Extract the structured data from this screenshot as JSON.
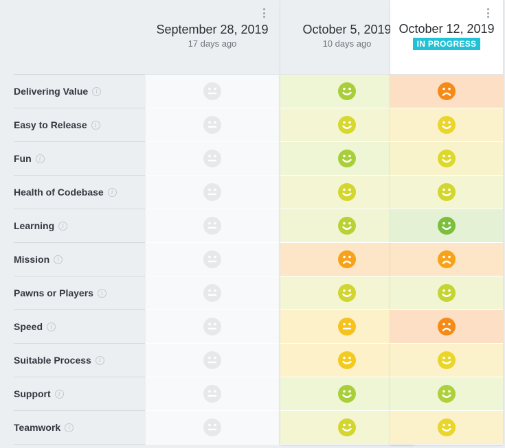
{
  "metrics": [
    {
      "name": "Delivering Value"
    },
    {
      "name": "Easy to Release"
    },
    {
      "name": "Fun"
    },
    {
      "name": "Health of Codebase"
    },
    {
      "name": "Learning"
    },
    {
      "name": "Mission"
    },
    {
      "name": "Pawns or Players"
    },
    {
      "name": "Speed"
    },
    {
      "name": "Suitable Process"
    },
    {
      "name": "Support"
    },
    {
      "name": "Teamwork"
    }
  ],
  "info_icon_glyph": "i",
  "sessions": [
    {
      "date": "September 28, 2019",
      "ago": "17 days ago",
      "status": "",
      "cells": [
        {
          "mood": "neutral",
          "face": "#e6e8ea",
          "bg": "#f8f9fa"
        },
        {
          "mood": "neutral",
          "face": "#e6e8ea",
          "bg": "#f8f9fa"
        },
        {
          "mood": "neutral",
          "face": "#e6e8ea",
          "bg": "#f8f9fa"
        },
        {
          "mood": "neutral",
          "face": "#e6e8ea",
          "bg": "#f8f9fa"
        },
        {
          "mood": "neutral",
          "face": "#e6e8ea",
          "bg": "#f8f9fa"
        },
        {
          "mood": "neutral",
          "face": "#e6e8ea",
          "bg": "#f8f9fa"
        },
        {
          "mood": "neutral",
          "face": "#e6e8ea",
          "bg": "#f8f9fa"
        },
        {
          "mood": "neutral",
          "face": "#e6e8ea",
          "bg": "#f8f9fa"
        },
        {
          "mood": "neutral",
          "face": "#e6e8ea",
          "bg": "#f8f9fa"
        },
        {
          "mood": "neutral",
          "face": "#e6e8ea",
          "bg": "#f8f9fa"
        },
        {
          "mood": "neutral",
          "face": "#e6e8ea",
          "bg": "#f8f9fa"
        }
      ]
    },
    {
      "date": "October 5, 2019",
      "ago": "10 days ago",
      "status": "",
      "cells": [
        {
          "mood": "happy",
          "face": "#a8cf3a",
          "bg": "#eef6d6"
        },
        {
          "mood": "happy",
          "face": "#d7d82e",
          "bg": "#f4f5d2"
        },
        {
          "mood": "happy",
          "face": "#a8cf3a",
          "bg": "#eef6d6"
        },
        {
          "mood": "happy",
          "face": "#d2d62e",
          "bg": "#f4f5d2"
        },
        {
          "mood": "happy",
          "face": "#b8d236",
          "bg": "#f1f5d4"
        },
        {
          "mood": "sad",
          "face": "#f7a21b",
          "bg": "#fde6c8"
        },
        {
          "mood": "happy",
          "face": "#d0d530",
          "bg": "#f4f5d2"
        },
        {
          "mood": "neutral",
          "face": "#f6c21d",
          "bg": "#fdf1c9"
        },
        {
          "mood": "happy",
          "face": "#f3ca20",
          "bg": "#fcf1c9"
        },
        {
          "mood": "happy",
          "face": "#a8cf3a",
          "bg": "#eef6d6"
        },
        {
          "mood": "happy",
          "face": "#d2d62e",
          "bg": "#f4f5d2"
        }
      ]
    },
    {
      "date": "October 12, 2019",
      "ago": "",
      "status": "IN PROGRESS",
      "cells": [
        {
          "mood": "sad",
          "face": "#f58b16",
          "bg": "#fddfc5"
        },
        {
          "mood": "happy",
          "face": "#ead52a",
          "bg": "#fbf2cb"
        },
        {
          "mood": "happy",
          "face": "#dcd82c",
          "bg": "#f9f3cc"
        },
        {
          "mood": "happy",
          "face": "#d2d62e",
          "bg": "#f4f5d2"
        },
        {
          "mood": "happy",
          "face": "#7cbf3c",
          "bg": "#e4f1d5"
        },
        {
          "mood": "sad",
          "face": "#f7a21b",
          "bg": "#fde6c8"
        },
        {
          "mood": "happy",
          "face": "#c4d532",
          "bg": "#f1f5d4"
        },
        {
          "mood": "sad",
          "face": "#f58b16",
          "bg": "#fddfc5"
        },
        {
          "mood": "happy",
          "face": "#ead52a",
          "bg": "#fbf2cb"
        },
        {
          "mood": "happy",
          "face": "#aed03a",
          "bg": "#eef6d6"
        },
        {
          "mood": "happy",
          "face": "#ead52a",
          "bg": "#fbf2cb"
        }
      ]
    }
  ]
}
